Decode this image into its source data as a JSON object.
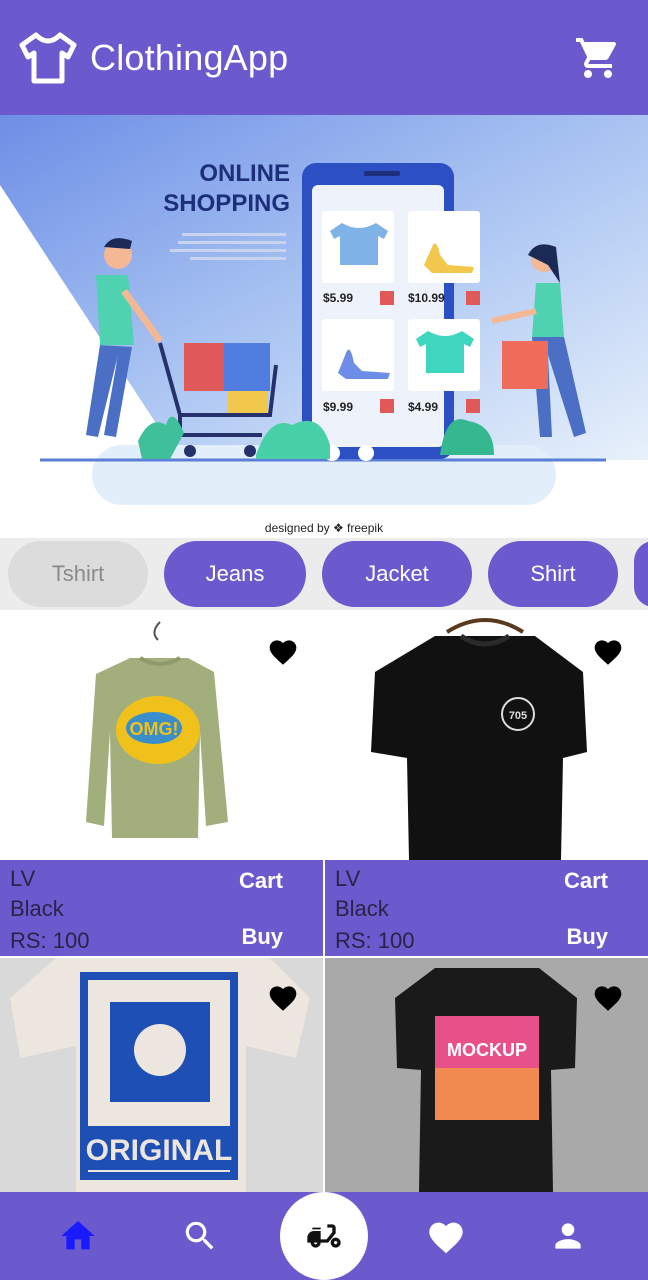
{
  "app": {
    "title": "ClothingApp",
    "logo_icon": "tshirt-icon",
    "cart_icon": "shopping-cart-icon"
  },
  "banner": {
    "headline_line1": "ONLINE",
    "headline_line2": "SHOPPING",
    "prices": [
      "$5.99",
      "$10.99",
      "$9.99",
      "$4.99"
    ],
    "credit": "designed by ❖ freepik"
  },
  "categories": [
    {
      "label": "Tshirt",
      "selected": false
    },
    {
      "label": "Jeans",
      "selected": true
    },
    {
      "label": "Jacket",
      "selected": true
    },
    {
      "label": "Shirt",
      "selected": true
    }
  ],
  "products": [
    {
      "brand": "LV",
      "color": "Black",
      "price": "RS: 100",
      "cart_label": "Cart",
      "buy_label": "Buy",
      "image": "green sweatshirt OMG"
    },
    {
      "brand": "LV",
      "color": "Black",
      "price": "RS: 100",
      "cart_label": "Cart",
      "buy_label": "Buy",
      "image": "black tshirt 705"
    },
    {
      "image": "white tshirt ORIGINAL"
    },
    {
      "image": "black tshirt MOCKUP"
    }
  ],
  "bottom_nav": {
    "items": [
      "home-icon",
      "search-icon",
      "delivery-scooter-icon",
      "heart-icon",
      "profile-icon"
    ],
    "active_color": "#1a1aff"
  },
  "colors": {
    "primary": "#6a5acd",
    "chip_inactive": "#dcdcdc"
  }
}
